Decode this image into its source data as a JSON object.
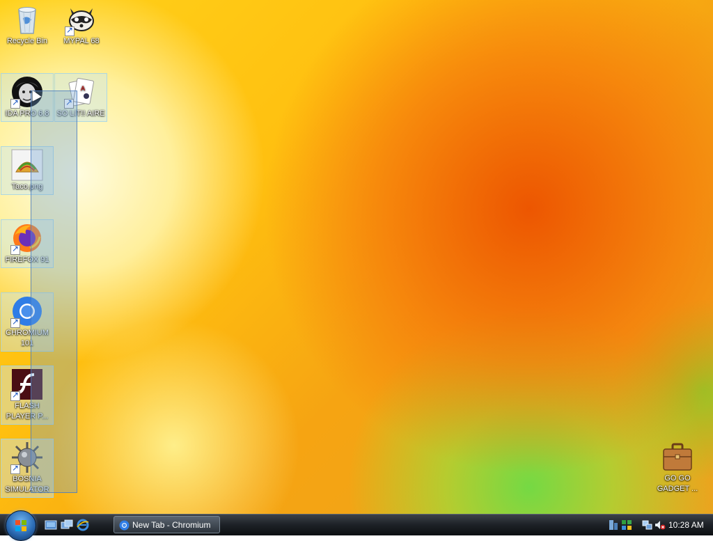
{
  "desktop": {
    "icons": [
      {
        "label": "Recycle Bin"
      },
      {
        "label": "MYPAL 68"
      },
      {
        "label": "IDA PRO 6.8"
      },
      {
        "label": "SO LIT!! AIRE"
      },
      {
        "label": "Taco.png"
      },
      {
        "label": "FIREFOX 91"
      },
      {
        "label": "CHROMIUM 101"
      },
      {
        "label": "FLASH PLAYER P..."
      },
      {
        "label": "BOSNIA SIMULATOR"
      },
      {
        "label": "GO GO GADGET ..."
      }
    ]
  },
  "taskbar": {
    "tasks": [
      {
        "label": "New Tab - Chromium"
      }
    ],
    "clock": "10:28 AM"
  },
  "colors": {
    "chromium_blue": "#1a73e8",
    "taskbar_dark": "#1d2126"
  }
}
